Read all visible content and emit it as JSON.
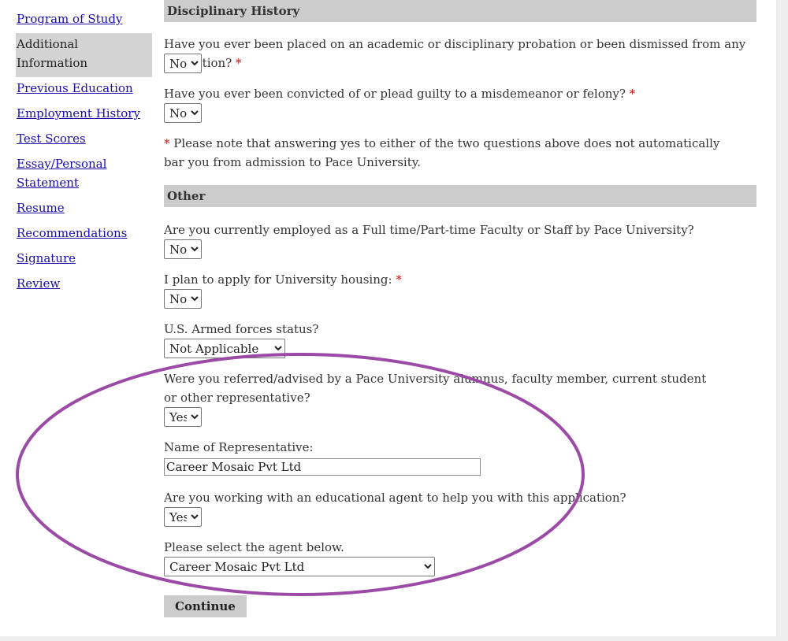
{
  "sidebar": {
    "items": [
      {
        "label": "Program of Study",
        "active": false
      },
      {
        "label": "Additional Information",
        "active": true
      },
      {
        "label": "Previous Education",
        "active": false
      },
      {
        "label": "Employment History",
        "active": false
      },
      {
        "label": "Test Scores",
        "active": false
      },
      {
        "label": "Essay/Personal Statement",
        "active": false
      },
      {
        "label": "Resume",
        "active": false
      },
      {
        "label": "Recommendations",
        "active": false
      },
      {
        "label": "Signature",
        "active": false
      },
      {
        "label": "Review",
        "active": false
      }
    ]
  },
  "disciplinary": {
    "header": "Disciplinary History",
    "q1": {
      "label": "Have you ever been placed on an academic or disciplinary probation or been dismissed from any institution?",
      "required_mark": "*",
      "value": "No"
    },
    "q2": {
      "label": "Have you ever been convicted of or plead guilty to a misdemeanor or felony?",
      "required_mark": "*",
      "value": "No"
    },
    "note_mark": "*",
    "note": "Please note that answering yes to either of the two questions above does not automatically bar you from admission to Pace University."
  },
  "other": {
    "header": "Other",
    "q_employed": {
      "label": "Are you currently employed as a Full time/Part-time Faculty or Staff by Pace University?",
      "value": "No"
    },
    "q_housing": {
      "label": "I plan to apply for University housing:",
      "required_mark": "*",
      "value": "No"
    },
    "q_armed": {
      "label": "U.S. Armed forces status?",
      "value": "Not Applicable"
    },
    "q_referred": {
      "label": "Were you referred/advised by a Pace University alumnus, faculty member, current student or other representative?",
      "value": "Yes"
    },
    "q_rep_name": {
      "label": "Name of Representative:",
      "value": "Career Mosaic Pvt Ltd"
    },
    "q_agent": {
      "label": "Are you working with an educational agent to help you with this application?",
      "value": "Yes"
    },
    "q_agent_select": {
      "label": "Please select the agent below.",
      "value": "Career Mosaic Pvt Ltd"
    }
  },
  "continue_label": "Continue",
  "colors": {
    "link": "#1a0dab",
    "required": "#d01010",
    "header_bg": "#cccccc",
    "annotation": "#9b4aa6"
  }
}
